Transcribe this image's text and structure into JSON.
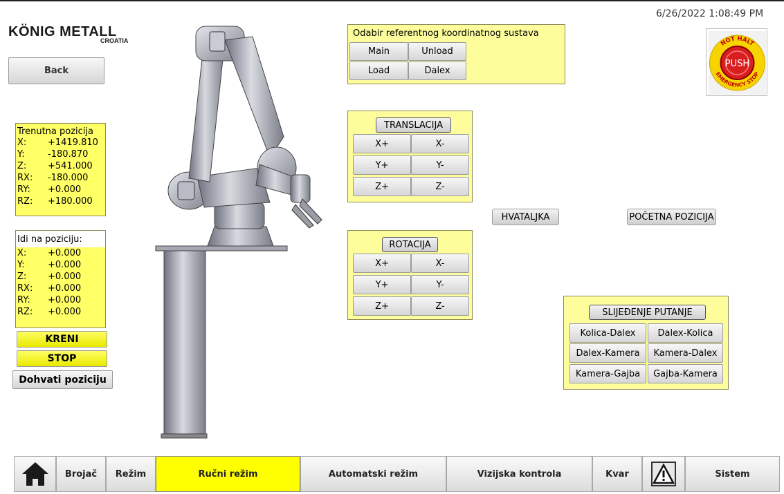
{
  "datetime": "6/26/2022 1:08:49 PM",
  "logo": {
    "main": "KÖNIG METALL",
    "sub": "CROATIA"
  },
  "back_label": "Back",
  "emergency": {
    "top": "NOT HALT",
    "center": "PUSH",
    "bottom": "EMERGENCY STOP"
  },
  "coord_system": {
    "title": "Odabir referentnog koordinatnog sustava",
    "buttons": [
      "Main",
      "Unload",
      "Load",
      "Dalex"
    ]
  },
  "translation": {
    "title": "TRANSLACIJA",
    "buttons": [
      "X+",
      "X-",
      "Y+",
      "Y-",
      "Z+",
      "Z-"
    ]
  },
  "rotation": {
    "title": "ROTACIJA",
    "buttons": [
      "X+",
      "X-",
      "Y+",
      "Y-",
      "Z+",
      "Z-"
    ]
  },
  "gripper_label": "HVATALJKA",
  "home_position_label": "POČETNA POZICIJA",
  "current_position": {
    "title": "Trenutna pozicija",
    "rows": [
      {
        "axis": "X:",
        "value": "+1419.810"
      },
      {
        "axis": "Y:",
        "value": "-180.870"
      },
      {
        "axis": "Z:",
        "value": "+541.000"
      },
      {
        "axis": "RX:",
        "value": "-180.000"
      },
      {
        "axis": "RY:",
        "value": "+0.000"
      },
      {
        "axis": "RZ:",
        "value": "+180.000"
      }
    ]
  },
  "goto_position": {
    "title": "Idi na poziciju:",
    "rows": [
      {
        "axis": "X:",
        "value": "+0.000"
      },
      {
        "axis": "Y:",
        "value": "+0.000"
      },
      {
        "axis": "Z:",
        "value": "+0.000"
      },
      {
        "axis": "RX:",
        "value": "+0.000"
      },
      {
        "axis": "RY:",
        "value": "+0.000"
      },
      {
        "axis": "RZ:",
        "value": "+0.000"
      }
    ]
  },
  "go_label": "KRENI",
  "stop_label": "STOP",
  "fetch_position_label": "Dohvati poziciju",
  "path_following": {
    "title": "SLIJEĐENJE PUTANJE",
    "buttons": [
      "Kolica-Dalex",
      "Dalex-Kolica",
      "Dalex-Kamera",
      "Kamera-Dalex",
      "Kamera-Gajba",
      "Gajba-Kamera"
    ]
  },
  "nav": {
    "home_icon": "home-icon",
    "items": [
      "Brojač",
      "Režim",
      "Ručni režim",
      "Automatski režim",
      "Vizijska kontrola",
      "Kvar"
    ],
    "warning_icon": "warning-icon",
    "system": "Sistem",
    "active_color": "#ffff00"
  }
}
